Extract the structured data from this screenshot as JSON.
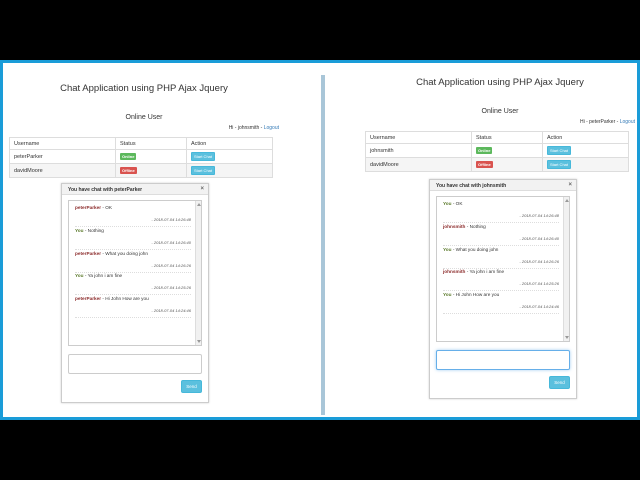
{
  "left": {
    "app_title": "Chat Application using PHP Ajax Jquery",
    "online_title": "Online User",
    "greeting_prefix": "Hi - johnsmith - ",
    "logout": "Logout",
    "columns": [
      "Username",
      "Status",
      "Action"
    ],
    "users": [
      {
        "username": "peterParker",
        "status": "Online",
        "action": "Start Chat"
      },
      {
        "username": "davidMoore",
        "status": "Offline",
        "action": "Start Chat"
      }
    ],
    "chat": {
      "title": "You have chat with peterParker",
      "close": "×",
      "messages": [
        {
          "sender": "peterParker",
          "text": " - OK",
          "time": "- 2018-07-04 14:26:48"
        },
        {
          "sender": "You",
          "text": " - Nothing",
          "time": "- 2018-07-04 14:26:40"
        },
        {
          "sender": "peterParker",
          "text": " - What you doing john",
          "time": "- 2018-07-04 14:26:26"
        },
        {
          "sender": "You",
          "text": " - Ya john i am fine",
          "time": "- 2018-07-04 14:25:26"
        },
        {
          "sender": "peterParker",
          "text": " - Hi John How are you",
          "time": "- 2018-07-04 14:24:46"
        }
      ],
      "send": "Send"
    }
  },
  "right": {
    "app_title": "Chat Application using PHP Ajax Jquery",
    "online_title": "Online User",
    "greeting_prefix": "Hi - peterParker - ",
    "logout": "Logout",
    "columns": [
      "Username",
      "Status",
      "Action"
    ],
    "users": [
      {
        "username": "johnsmith",
        "status": "Online",
        "action": "Start Chat"
      },
      {
        "username": "davidMoore",
        "status": "Offline",
        "action": "Start Chat"
      }
    ],
    "chat": {
      "title": "You have chat with johnsmith",
      "close": "×",
      "messages": [
        {
          "sender": "You",
          "text": " - OK",
          "time": "- 2018-07-04 14:26:48"
        },
        {
          "sender": "johnsmith",
          "text": " - Nothing",
          "time": "- 2018-07-04 14:26:40"
        },
        {
          "sender": "You",
          "text": " - What you doing john",
          "time": "- 2018-07-04 14:26:26"
        },
        {
          "sender": "johnsmith",
          "text": " - Ya john i am fine",
          "time": "- 2018-07-04 14:25:26"
        },
        {
          "sender": "You",
          "text": " - Hi John How are you",
          "time": "- 2018-07-04 14:24:46"
        }
      ],
      "send": "Send"
    }
  }
}
